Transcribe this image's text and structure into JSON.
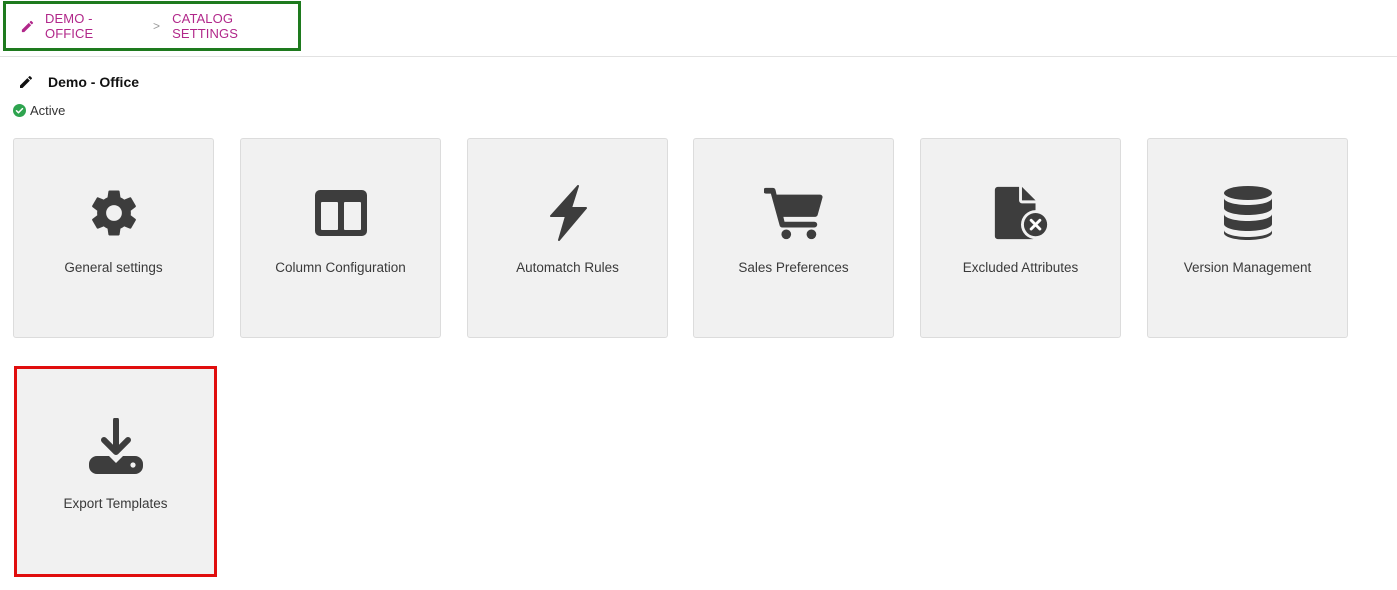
{
  "breadcrumb": {
    "items": [
      "DEMO - OFFICE",
      "CATALOG SETTINGS"
    ],
    "separator": ">"
  },
  "entity": {
    "title": "Demo - Office",
    "status": "Active"
  },
  "tiles": [
    {
      "label": "General settings",
      "icon": "gear-icon"
    },
    {
      "label": "Column Configuration",
      "icon": "columns-icon"
    },
    {
      "label": "Automatch Rules",
      "icon": "lightning-icon"
    },
    {
      "label": "Sales Preferences",
      "icon": "cart-icon"
    },
    {
      "label": "Excluded Attributes",
      "icon": "file-excluded-icon"
    },
    {
      "label": "Version Management",
      "icon": "database-icon"
    },
    {
      "label": "Export Templates",
      "icon": "download-icon"
    }
  ],
  "colors": {
    "accent": "#b1278a",
    "icon": "#3d3d3d",
    "active": "#2ea44f",
    "green_highlight": "#1e7a1e",
    "red_highlight": "#e00d0d"
  }
}
